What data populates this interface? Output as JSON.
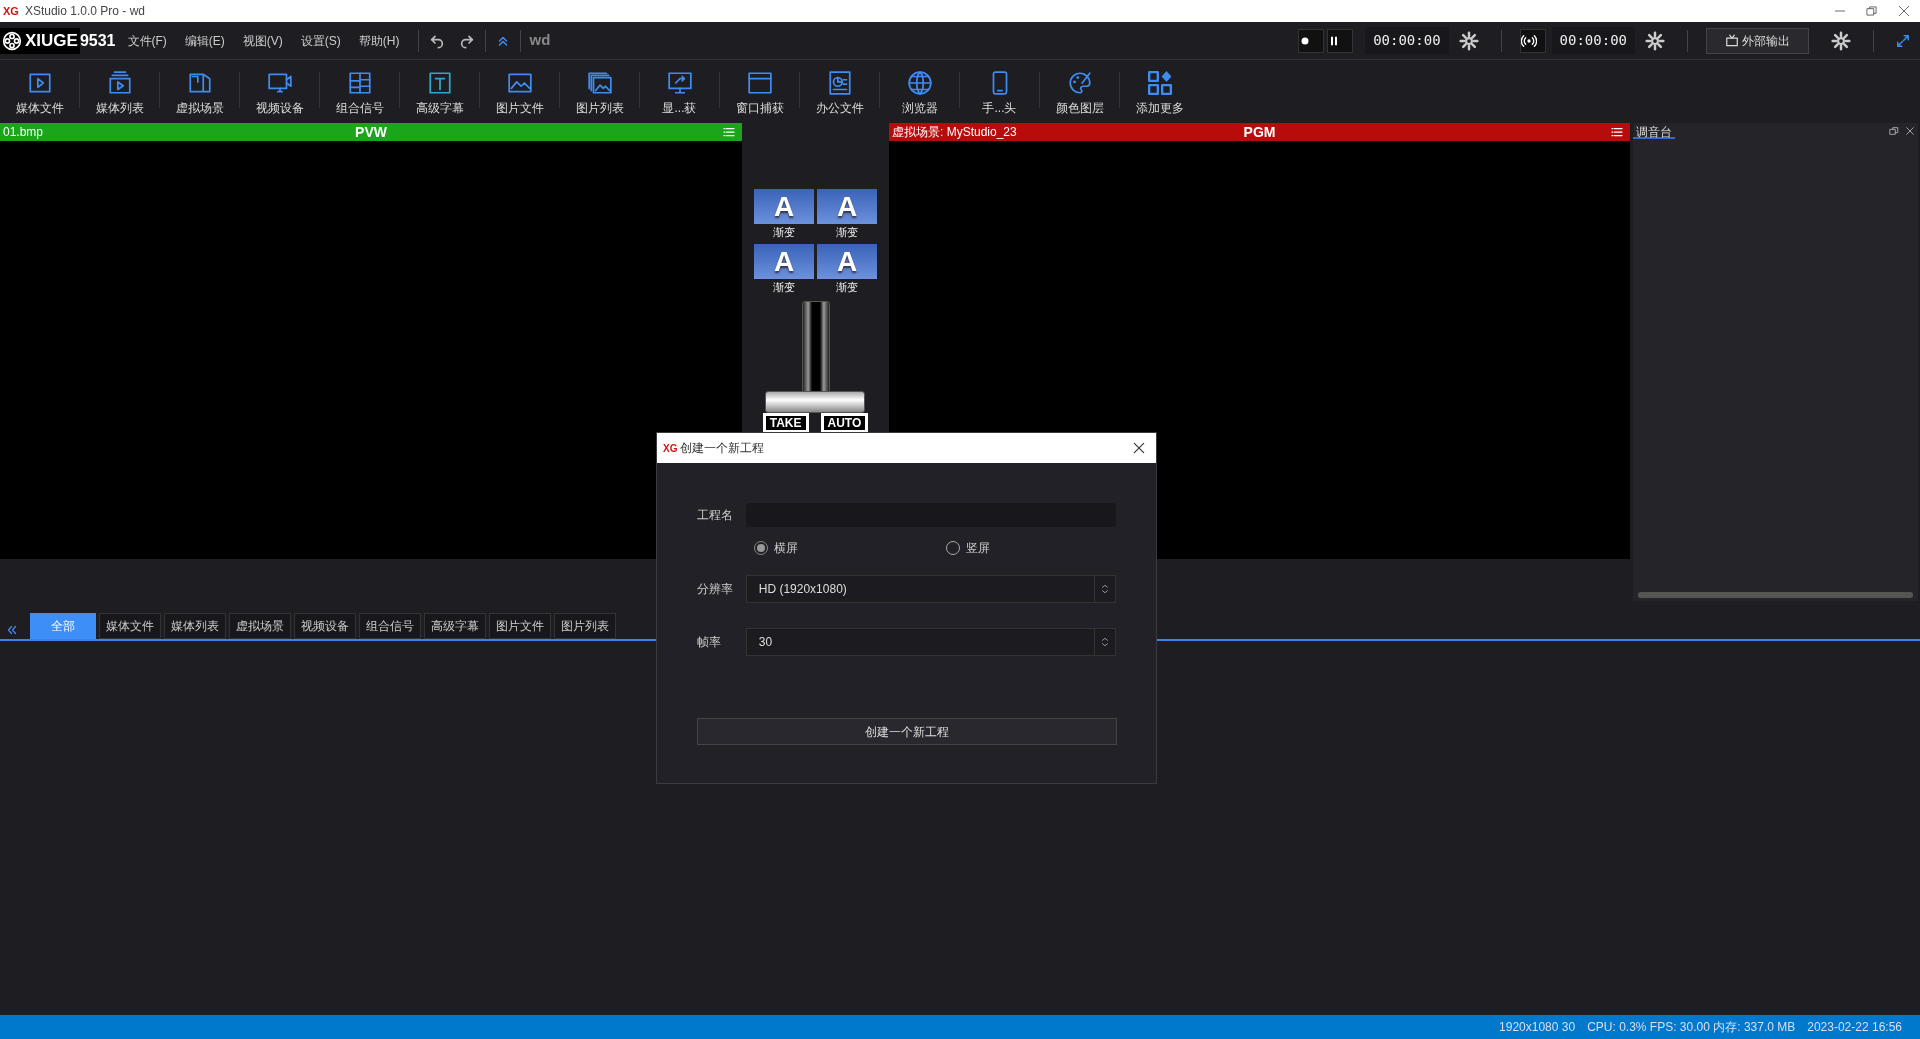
{
  "window": {
    "logo": "XG",
    "title": "XStudio 1.0.0 Pro - wd"
  },
  "menu_bar": {
    "logo": "XIUGE",
    "logo_number": "9531",
    "menus": [
      "文件(F)",
      "编辑(E)",
      "视图(V)",
      "设置(S)",
      "帮助(H)"
    ],
    "project": "wd"
  },
  "recording": {
    "timer": "00:00:00"
  },
  "streaming": {
    "timer": "00:00:00"
  },
  "output_button": "外部输出",
  "toolbar": [
    {
      "label": "媒体文件"
    },
    {
      "label": "媒体列表"
    },
    {
      "label": "虚拟场景"
    },
    {
      "label": "视频设备"
    },
    {
      "label": "组合信号"
    },
    {
      "label": "高级字幕"
    },
    {
      "label": "图片文件"
    },
    {
      "label": "图片列表"
    },
    {
      "label": "显...获"
    },
    {
      "label": "窗口捕获"
    },
    {
      "label": "办公文件"
    },
    {
      "label": "浏览器"
    },
    {
      "label": "手...头"
    },
    {
      "label": "颜色图层"
    },
    {
      "label": "添加更多"
    }
  ],
  "preview": {
    "source": "01.bmp",
    "label": "PVW"
  },
  "program": {
    "source": "虚拟场景: MyStudio_23",
    "label": "PGM"
  },
  "transitions": [
    {
      "glyph": "A",
      "label": "渐变"
    },
    {
      "glyph": "A",
      "label": "渐变"
    },
    {
      "glyph": "A",
      "label": "渐变"
    },
    {
      "glyph": "A",
      "label": "渐变"
    }
  ],
  "tbar": {
    "level": 0
  },
  "take_button": "TAKE",
  "auto_button": "AUTO",
  "mixer_panel": {
    "title": "调音台"
  },
  "source_tabs": [
    {
      "label": "全部",
      "selected": true
    },
    {
      "label": "媒体文件",
      "selected": false
    },
    {
      "label": "媒体列表",
      "selected": false
    },
    {
      "label": "虚拟场景",
      "selected": false
    },
    {
      "label": "视频设备",
      "selected": false
    },
    {
      "label": "组合信号",
      "selected": false
    },
    {
      "label": "高级字幕",
      "selected": false
    },
    {
      "label": "图片文件",
      "selected": false
    },
    {
      "label": "图片列表",
      "selected": false
    }
  ],
  "dialog": {
    "logo": "XG",
    "title": "创建一个新工程",
    "name_label": "工程名",
    "orientation": [
      {
        "label": "横屏",
        "selected": true
      },
      {
        "label": "竖屏",
        "selected": false
      }
    ],
    "resolution": {
      "label": "分辨率",
      "value": "HD (1920x1080)"
    },
    "frame_rate": {
      "label": "帧率",
      "value": "30"
    },
    "submit": "创建一个新工程"
  },
  "status_bar": {
    "format": "1920x1080 30",
    "stats": "CPU: 0.3% FPS: 30.00 内存: 337.0 MB",
    "datetime": "2023-02-22 16:56"
  }
}
